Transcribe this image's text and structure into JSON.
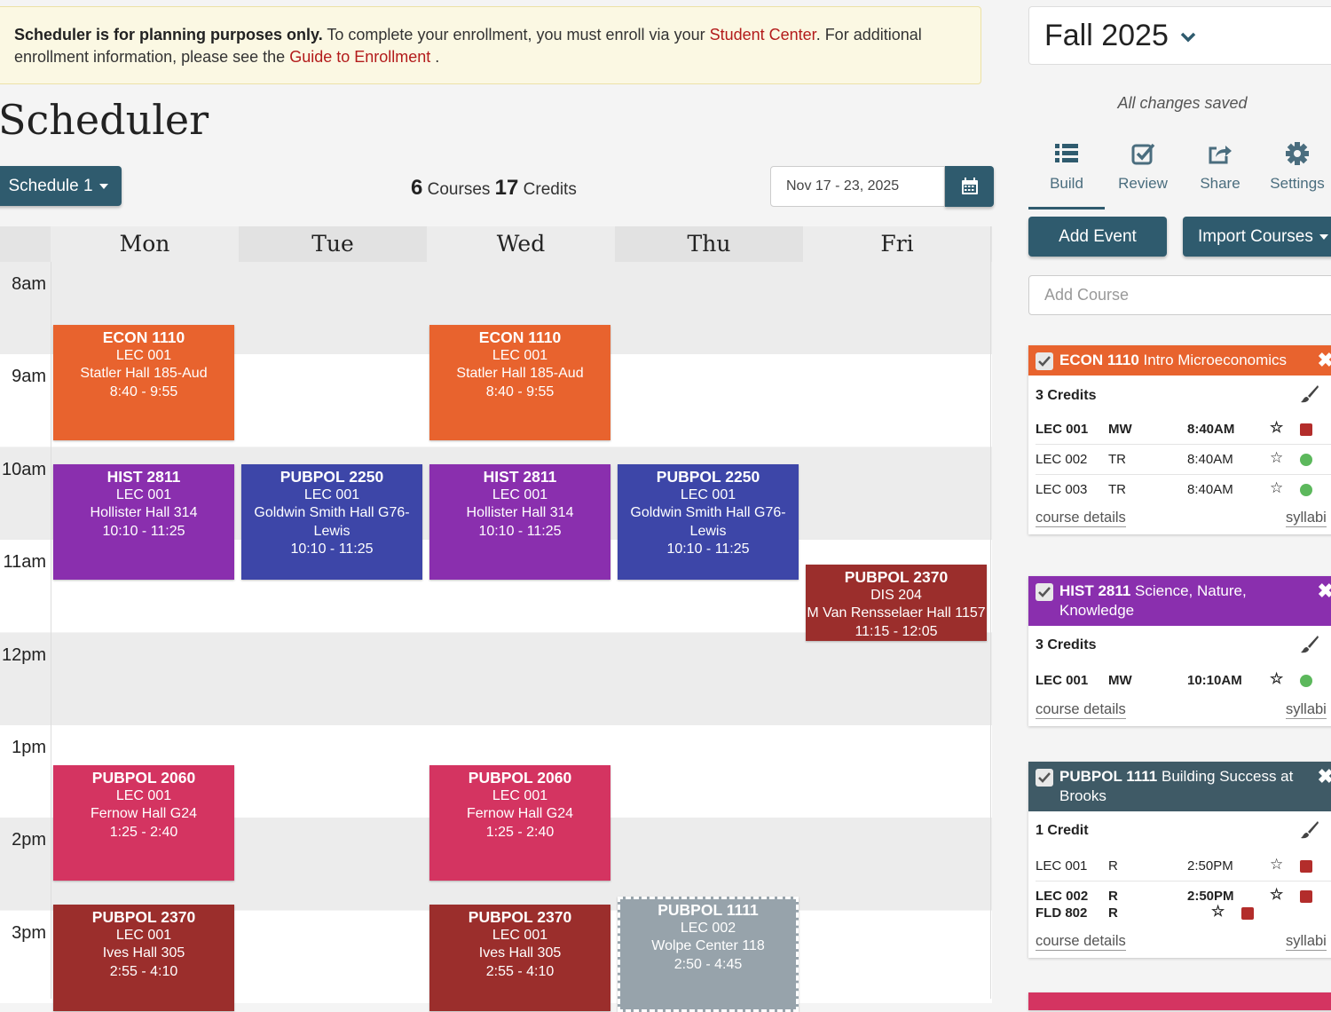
{
  "notice": {
    "bold": "Scheduler is for planning purposes only.",
    "text1": " To complete your enrollment, you must enroll via your ",
    "link1": "Student Center",
    "text2": ". For additional enrollment information, please see the ",
    "link2": "Guide to Enrollment",
    "text3": " ."
  },
  "page_title": "Scheduler",
  "schedule_button": "Schedule 1",
  "summary": {
    "courses": "6",
    "courses_label": "Courses",
    "credits": "17",
    "credits_label": "Credits"
  },
  "date_range": "Nov 17 - 23, 2025",
  "calendar": {
    "days": [
      "Mon",
      "Tue",
      "Wed",
      "Thu",
      "Fri"
    ],
    "hours": [
      "8am",
      "9am",
      "10am",
      "11am",
      "12pm",
      "1pm",
      "2pm",
      "3pm"
    ],
    "events": [
      {
        "code": "ECON 1110",
        "section": "LEC 001",
        "location": "Statler Hall 185-Aud",
        "time": "8:40 - 9:55",
        "color": "#e8632e"
      },
      {
        "code": "ECON 1110",
        "section": "LEC 001",
        "location": "Statler Hall 185-Aud",
        "time": "8:40 - 9:55",
        "color": "#e8632e"
      },
      {
        "code": "HIST 2811",
        "section": "LEC 001",
        "location": "Hollister Hall 314",
        "time": "10:10 - 11:25",
        "color": "#8a2fae"
      },
      {
        "code": "PUBPOL 2250",
        "section": "LEC 001",
        "location": "Goldwin Smith Hall G76-Lewis",
        "time": "10:10 - 11:25",
        "color": "#3d46a8"
      },
      {
        "code": "HIST 2811",
        "section": "LEC 001",
        "location": "Hollister Hall 314",
        "time": "10:10 - 11:25",
        "color": "#8a2fae"
      },
      {
        "code": "PUBPOL 2250",
        "section": "LEC 001",
        "location": "Goldwin Smith Hall G76-Lewis",
        "time": "10:10 - 11:25",
        "color": "#3d46a8"
      },
      {
        "code": "PUBPOL 2370",
        "section": "DIS 204",
        "location": "M Van Rensselaer Hall 1157",
        "time": "11:15 - 12:05",
        "color": "#9b2e2c"
      },
      {
        "code": "PUBPOL 2060",
        "section": "LEC 001",
        "location": "Fernow Hall G24",
        "time": "1:25 - 2:40",
        "color": "#d43461"
      },
      {
        "code": "PUBPOL 2060",
        "section": "LEC 001",
        "location": "Fernow Hall G24",
        "time": "1:25 - 2:40",
        "color": "#d43461"
      },
      {
        "code": "PUBPOL 2370",
        "section": "LEC 001",
        "location": "Ives Hall 305",
        "time": "2:55 - 4:10",
        "color": "#9b2e2c"
      },
      {
        "code": "PUBPOL 2370",
        "section": "LEC 001",
        "location": "Ives Hall 305",
        "time": "2:55 - 4:10",
        "color": "#9b2e2c"
      },
      {
        "code": "PUBPOL 1111",
        "section": "LEC 002",
        "location": "Wolpe Center 118",
        "time": "2:50 - 4:45",
        "color": "#97a3ab"
      }
    ]
  },
  "term": "Fall 2025",
  "save_status": "All changes saved",
  "tabs": [
    {
      "label": "Build",
      "icon": "list-icon"
    },
    {
      "label": "Review",
      "icon": "checkbox-icon"
    },
    {
      "label": "Share",
      "icon": "share-icon"
    },
    {
      "label": "Settings",
      "icon": "gear-icon"
    }
  ],
  "add_event": "Add Event",
  "import_courses": "Import Courses",
  "add_course_placeholder": "Add Course",
  "course_cards": [
    {
      "code": "ECON 1110",
      "title": " Intro Microeconomics",
      "color": "#e8632e",
      "credits": "3 Credits",
      "sections": [
        {
          "name": "LEC 001",
          "days": "MW",
          "time": "8:40AM",
          "status": "red"
        },
        {
          "name": "LEC 002",
          "days": "TR",
          "time": "8:40AM",
          "status": "green"
        },
        {
          "name": "LEC 003",
          "days": "TR",
          "time": "8:40AM",
          "status": "green"
        }
      ],
      "details": "course details",
      "syllabi": "syllabi"
    },
    {
      "code": "HIST 2811",
      "title": " Science, Nature, Knowledge",
      "color": "#8a2fae",
      "credits": "3 Credits",
      "sections": [
        {
          "name": "LEC 001",
          "days": "MW",
          "time": "10:10AM",
          "status": "green"
        }
      ],
      "details": "course details",
      "syllabi": "syllabi"
    },
    {
      "code": "PUBPOL 1111",
      "title": " Building Success at Brooks",
      "color": "#3f5a66",
      "credits": "1 Credit",
      "sections": [
        {
          "name": "LEC 001",
          "days": "R",
          "time": "2:50PM",
          "status": "red"
        },
        {
          "name": "LEC 002",
          "days": "R",
          "time": "2:50PM",
          "status": "red",
          "extra": "FLD 802",
          "extra_days": "R"
        }
      ],
      "details": "course details",
      "syllabi": "syllabi"
    }
  ],
  "colors": {
    "accent": "#2f5b6e",
    "status_red": "#b32d2b",
    "status_green": "#5cb85c",
    "link": "#b31b1b"
  }
}
